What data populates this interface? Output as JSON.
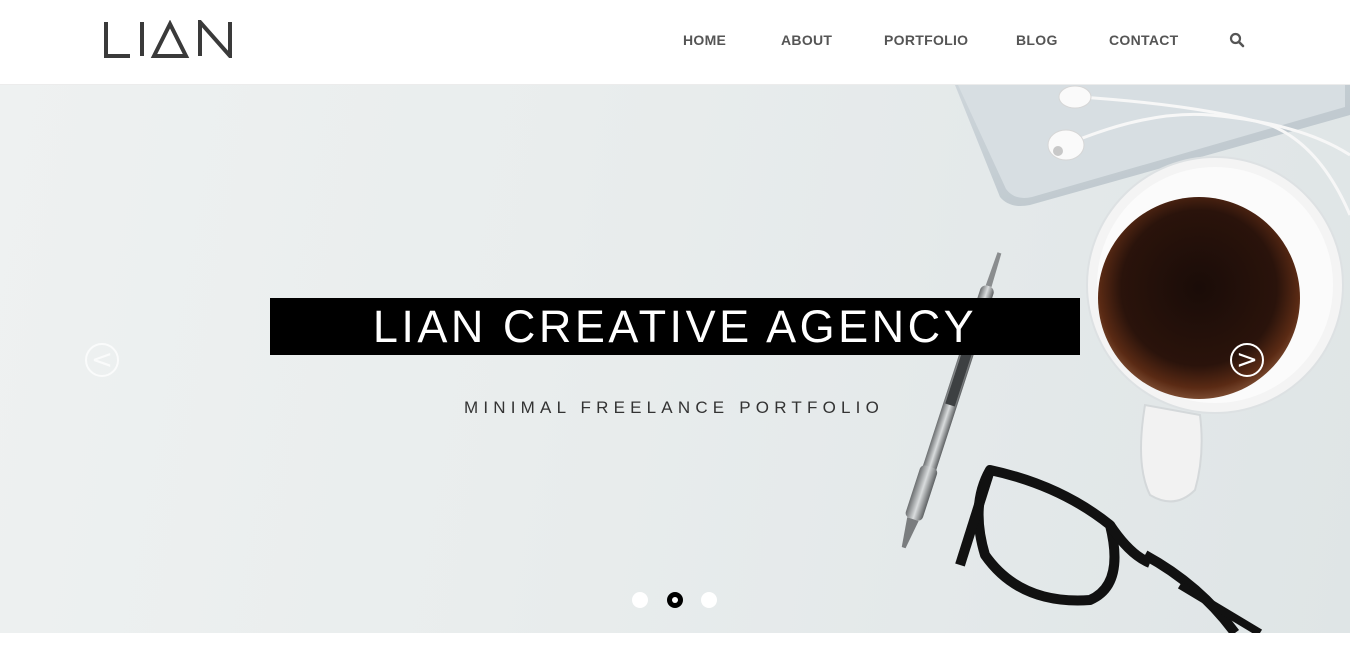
{
  "brand": {
    "logo_text": "LIAN"
  },
  "nav": {
    "items": [
      {
        "label": "HOME"
      },
      {
        "label": "ABOUT"
      },
      {
        "label": "PORTFOLIO"
      },
      {
        "label": "BLOG"
      },
      {
        "label": "CONTACT"
      }
    ],
    "search_icon": "search-icon"
  },
  "hero": {
    "title": "LIAN CREATIVE AGENCY",
    "subtitle": "MINIMAL FREELANCE PORTFOLIO",
    "prev_arrow": "<",
    "next_arrow": ">",
    "slides_total": 3,
    "active_slide": 2
  },
  "colors": {
    "title_bg": "#000000",
    "nav_text": "#555555",
    "hero_bg": "#e9eded"
  }
}
